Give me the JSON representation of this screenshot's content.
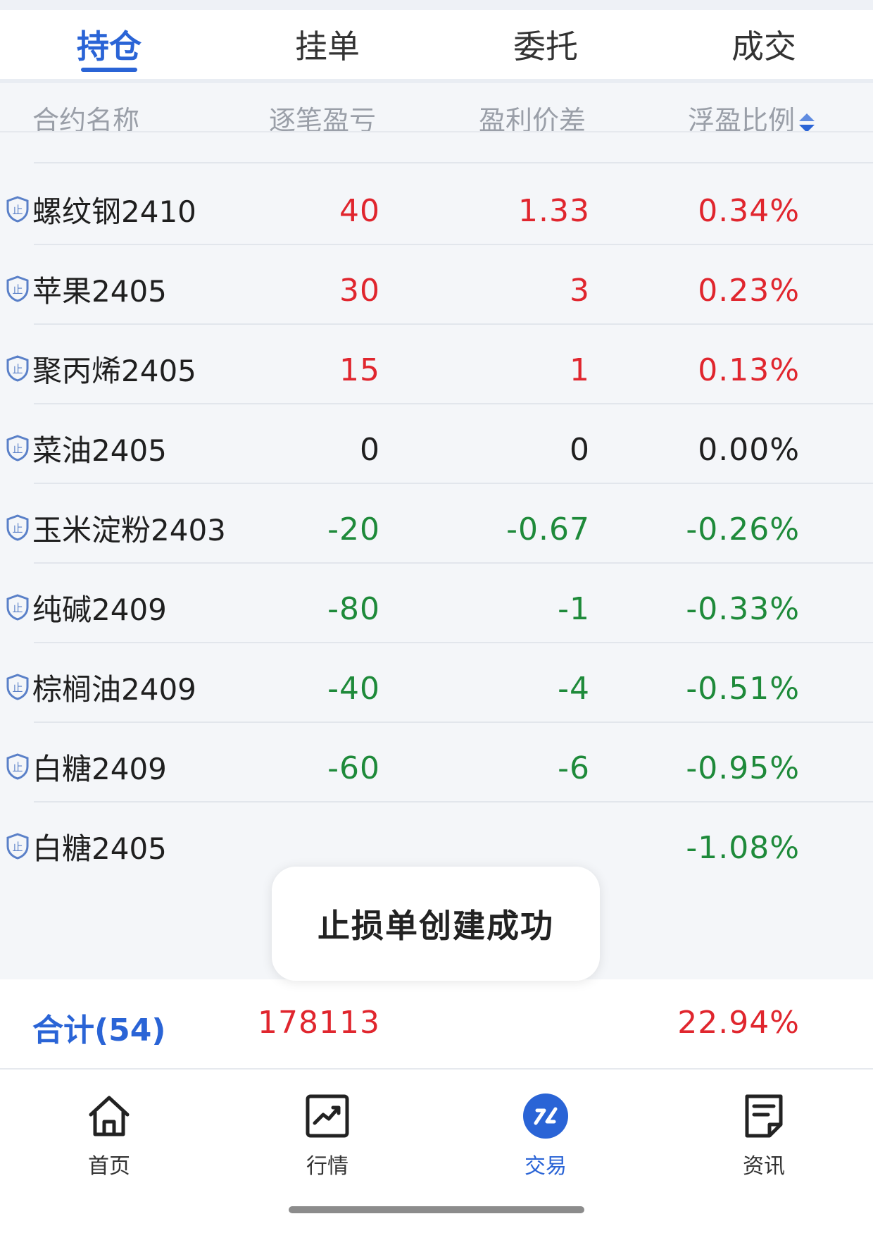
{
  "tabs": [
    {
      "label": "持仓",
      "active": true
    },
    {
      "label": "挂单",
      "active": false
    },
    {
      "label": "委托",
      "active": false
    },
    {
      "label": "成交",
      "active": false
    }
  ],
  "table": {
    "columns": [
      "合约名称",
      "逐笔盈亏",
      "盈利价差",
      "浮盈比例"
    ],
    "sorted_column": "浮盈比例",
    "rows": [
      {
        "name": "螺纹钢2410",
        "pnl": "40",
        "spread": "1.33",
        "ratio": "0.34%",
        "trend": "red"
      },
      {
        "name": "苹果2405",
        "pnl": "30",
        "spread": "3",
        "ratio": "0.23%",
        "trend": "red"
      },
      {
        "name": "聚丙烯2405",
        "pnl": "15",
        "spread": "1",
        "ratio": "0.13%",
        "trend": "red"
      },
      {
        "name": "菜油2405",
        "pnl": "0",
        "spread": "0",
        "ratio": "0.00%",
        "trend": "black"
      },
      {
        "name": "玉米淀粉2403",
        "pnl": "-20",
        "spread": "-0.67",
        "ratio": "-0.26%",
        "trend": "green"
      },
      {
        "name": "纯碱2409",
        "pnl": "-80",
        "spread": "-1",
        "ratio": "-0.33%",
        "trend": "green"
      },
      {
        "name": "棕榈油2409",
        "pnl": "-40",
        "spread": "-4",
        "ratio": "-0.51%",
        "trend": "green"
      },
      {
        "name": "白糖2409",
        "pnl": "-60",
        "spread": "-6",
        "ratio": "-0.95%",
        "trend": "green"
      },
      {
        "name": "白糖2405",
        "pnl": "",
        "spread": "",
        "ratio": "-1.08%",
        "trend": "green"
      }
    ]
  },
  "total": {
    "label": "合计(54)",
    "pnl": "178113",
    "ratio": "22.94%"
  },
  "toast": {
    "message": "止损单创建成功"
  },
  "bottom_nav": [
    {
      "label": "首页",
      "icon": "home-icon",
      "active": false
    },
    {
      "label": "行情",
      "icon": "chart-icon",
      "active": false
    },
    {
      "label": "交易",
      "icon": "trade-icon",
      "active": true
    },
    {
      "label": "资讯",
      "icon": "news-icon",
      "active": false
    }
  ],
  "colors": {
    "accent": "#2a64d6",
    "profit": "#e0262e",
    "loss": "#1e8a3a"
  }
}
